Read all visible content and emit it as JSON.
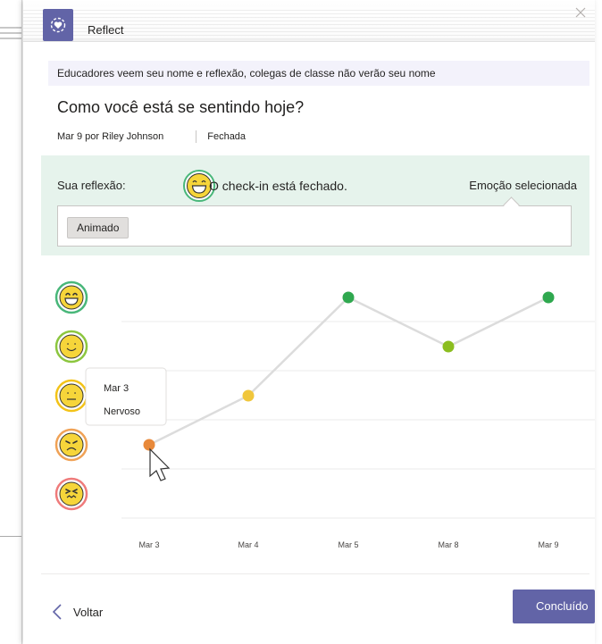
{
  "app": {
    "title": "Reflect",
    "icon": "heart-shield-icon"
  },
  "notice": "Educadores veem seu nome e reflexão, colegas de classe não verão seu nome",
  "question": "Como você está se sentindo hoje?",
  "meta": {
    "date_author": "Mar 9 por Riley Johnson",
    "status": "Fechada"
  },
  "reflection": {
    "label": "Sua reflexão:",
    "status": "O check-in está fechado.",
    "selected_label": "Emoção selecionada",
    "selected_emotion": "Animado"
  },
  "emotion_scale": [
    {
      "name": "excited-face-icon",
      "color": "#49b77a"
    },
    {
      "name": "happy-face-icon",
      "color": "#8cc63f"
    },
    {
      "name": "neutral-face-icon",
      "color": "#f3c318"
    },
    {
      "name": "sad-face-icon",
      "color": "#f0a256"
    },
    {
      "name": "distressed-face-icon",
      "color": "#ef7b7b"
    }
  ],
  "chart_data": {
    "type": "line",
    "categories": [
      "Mar 3",
      "Mar 4",
      "Mar 5",
      "Mar 8",
      "Mar 9"
    ],
    "values": [
      2,
      3,
      5,
      4,
      5
    ],
    "point_colors": [
      "#e8893a",
      "#f0c63c",
      "#2fa84f",
      "#8bbd1f",
      "#2fa84f"
    ],
    "ylim": [
      1,
      5
    ],
    "grid": true
  },
  "tooltip": {
    "date": "Mar 3",
    "emotion": "Nervoso"
  },
  "footer": {
    "back_label": "Voltar",
    "done_label": "Concluído"
  }
}
